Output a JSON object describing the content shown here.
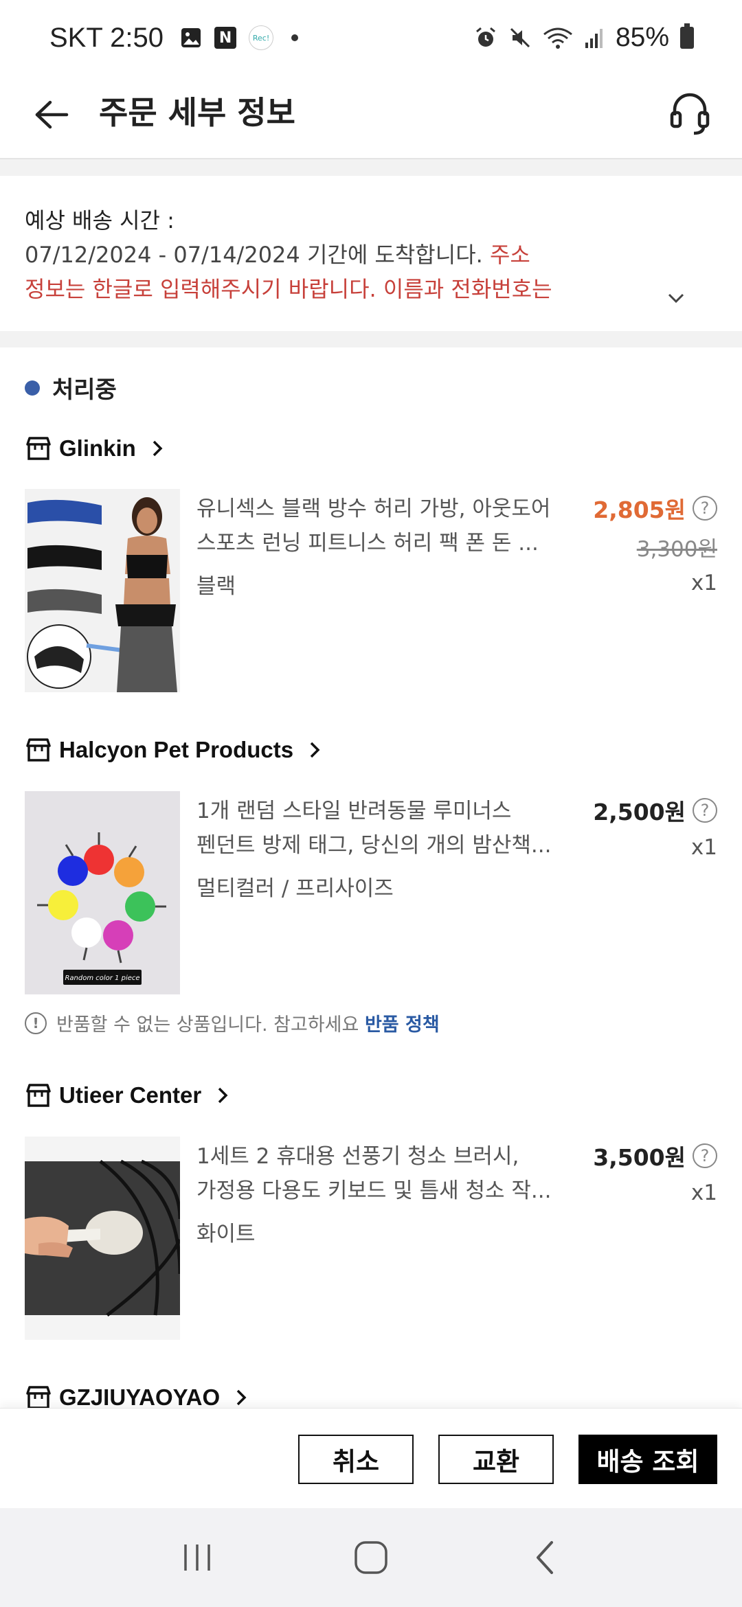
{
  "status_bar": {
    "carrier_time": "SKT 2:50",
    "n_badge": "N",
    "rec_badge": "Rec!",
    "battery": "85%"
  },
  "header": {
    "title": "주문 세부 정보"
  },
  "delivery": {
    "label": "예상 배송 시간 :",
    "dates": "07/12/2024 - 07/14/2024 기간에 도착합니다. ",
    "note_start": "주소",
    "note_line2": "정보는 한글로 입력해주시기 바랍니다. 이름과 전화번호는"
  },
  "order_status": "처리중",
  "shops": [
    {
      "name": "Glinkin",
      "product": {
        "title_l1": "유니섹스 블랙 방수 허리 가방, 아웃도어",
        "title_l2": "스포츠 런닝 피트니스 허리 팩 폰 돈 ...",
        "option": "블랙",
        "price": "2,805원",
        "orig_price": "3,300원",
        "qty": "x1"
      }
    },
    {
      "name": "Halcyon Pet Products",
      "product": {
        "title_l1": "1개 랜덤 스타일 반려동물 루미너스",
        "title_l2": "펜던트 방제 태그, 당신의 개의 밤산책...",
        "option": "멀티컬러 / 프리사이즈",
        "price": "2,500원",
        "qty": "x1",
        "image_caption": "Random color 1 piece"
      }
    },
    {
      "name": "Utieer Center",
      "product": {
        "title_l1": "1세트 2 휴대용 선풍기 청소 브러시,",
        "title_l2": "가정용 다용도 키보드 및 틈새 청소 작...",
        "option": "화이트",
        "price": "3,500원",
        "qty": "x1"
      }
    },
    {
      "name": "GZJIUYAOYAO"
    }
  ],
  "return_note": {
    "text": "반품할 수 없는 상품입니다. 참고하세요 ",
    "link": "반품 정책"
  },
  "actions": {
    "cancel": "취소",
    "exchange": "교환",
    "track": "배송 조회"
  },
  "colors": {
    "sale_price": "#e06a35",
    "notice_red": "#c7403a",
    "status_dot": "#3a5fa8",
    "link_blue": "#2a5aa3"
  }
}
